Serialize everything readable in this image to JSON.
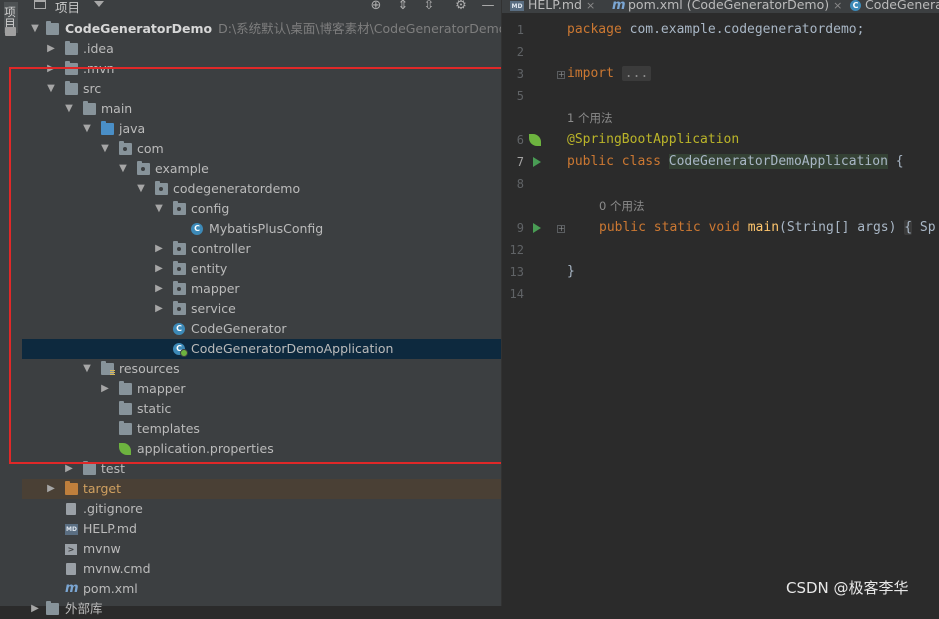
{
  "sidebar": {
    "tab_label": "项目"
  },
  "project_panel": {
    "title": "项目",
    "root": {
      "name": "CodeGeneratorDemo",
      "path": "D:\\系统默认\\桌面\\博客素材\\CodeGeneratorDemo"
    },
    "nodes": {
      "idea": ".idea",
      "mvn": ".mvn",
      "src": "src",
      "main": "main",
      "java": "java",
      "com": "com",
      "example": "example",
      "codegeneratordemo": "codegeneratordemo",
      "config": "config",
      "mybatisplusconfig": "MybatisPlusConfig",
      "controller": "controller",
      "entity": "entity",
      "mapper": "mapper",
      "service": "service",
      "codegenerator": "CodeGenerator",
      "app": "CodeGeneratorDemoApplication",
      "resources": "resources",
      "res_mapper": "mapper",
      "static": "static",
      "templates": "templates",
      "app_props": "application.properties",
      "test": "test",
      "target": "target",
      "gitignore": ".gitignore",
      "help_md": "HELP.md",
      "mvnw": "mvnw",
      "mvnw_cmd": "mvnw.cmd",
      "pom": "pom.xml",
      "external": "外部库"
    },
    "icons": {
      "class_letter": "C",
      "md_badge": "MD",
      "maven_letter": "m"
    }
  },
  "editor": {
    "tabs": [
      {
        "label": "HELP.md",
        "icon": "md-icon"
      },
      {
        "label": "pom.xml (CodeGeneratorDemo)",
        "icon": "maven-icon"
      },
      {
        "label": "CodeGenera",
        "icon": "class-icon"
      }
    ],
    "tab_close": "×",
    "line_numbers": [
      "1",
      "2",
      "3",
      "5",
      "6",
      "7",
      "8",
      "9",
      "12",
      "13",
      "14"
    ],
    "code": {
      "l1_kw": "package",
      "l1_rest": " com.example.codegeneratordemo;",
      "l3_kw": "import",
      "l3_folded": "...",
      "usages_1": "1 个用法",
      "l6_ann": "@SpringBootApplication",
      "l7_kw": "public class",
      "l7_name": "CodeGeneratorDemoApplication",
      "l7_brace": " {",
      "usages_0": "0 个用法",
      "l9_kw": "public static void",
      "l9_fn": "main",
      "l9_args": "(String[] args)",
      "l9_fold": "{",
      "l9_tail": " Sp",
      "l13": "}"
    }
  },
  "watermark": "CSDN @极客李华",
  "colors": {
    "selection": "#0d293e",
    "annotation_box": "#e02828",
    "accent_blue": "#4a8fc7",
    "target_orange": "#c07f3c"
  }
}
